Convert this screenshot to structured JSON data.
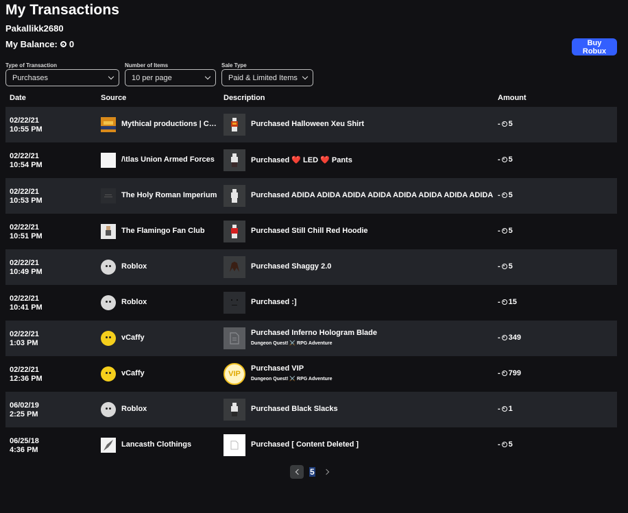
{
  "header": {
    "title": "My Transactions",
    "username": "Pakallikk2680",
    "balance_label": "My Balance:",
    "balance_value": "0",
    "buy_button": "Buy Robux"
  },
  "filters": {
    "type": {
      "label": "Type of Transaction",
      "value": "Purchases"
    },
    "items": {
      "label": "Number of Items",
      "value": "10 per page"
    },
    "sale": {
      "label": "Sale Type",
      "value": "Paid & Limited Items"
    }
  },
  "columns": {
    "date": "Date",
    "source": "Source",
    "description": "Description",
    "amount": "Amount"
  },
  "rows": [
    {
      "date": "02/22/21",
      "time": "10:55 PM",
      "source": "Mythical productions | CH...",
      "description": "Purchased Halloween Xeu Shirt",
      "sub": "",
      "amount": "-",
      "amount_value": "5"
    },
    {
      "date": "02/22/21",
      "time": "10:54 PM",
      "source": "/\\tlas Union Armed Forces",
      "description": "Purchased ❤️ LED ❤️ Pants",
      "sub": "",
      "amount": "-",
      "amount_value": "5"
    },
    {
      "date": "02/22/21",
      "time": "10:53 PM",
      "source": "The Holy Roman Imperium",
      "description": "Purchased ADIDA ADIDA ADIDA ADIDA ADIDA ADIDA ADIDA ADIDA",
      "sub": "",
      "amount": "-",
      "amount_value": "5"
    },
    {
      "date": "02/22/21",
      "time": "10:51 PM",
      "source": "The Flamingo Fan Club",
      "description": "Purchased Still Chill Red Hoodie",
      "sub": "",
      "amount": "-",
      "amount_value": "5"
    },
    {
      "date": "02/22/21",
      "time": "10:49 PM",
      "source": "Roblox",
      "description": "Purchased Shaggy 2.0",
      "sub": "",
      "amount": "-",
      "amount_value": "5"
    },
    {
      "date": "02/22/21",
      "time": "10:41 PM",
      "source": "Roblox",
      "description": "Purchased :]",
      "sub": "",
      "amount": "-",
      "amount_value": "15"
    },
    {
      "date": "02/22/21",
      "time": "1:03 PM",
      "source": "vCaffy",
      "description": "Purchased Inferno Hologram Blade",
      "sub": "Dungeon Quest! ⚔️ RPG Adventure",
      "amount": "-",
      "amount_value": "349"
    },
    {
      "date": "02/22/21",
      "time": "12:36 PM",
      "source": "vCaffy",
      "description": "Purchased VIP",
      "sub": "Dungeon Quest! ⚔️ RPG Adventure",
      "amount": "-",
      "amount_value": "799"
    },
    {
      "date": "06/02/19",
      "time": "2:25 PM",
      "source": "Roblox",
      "description": "Purchased Black Slacks",
      "sub": "",
      "amount": "-",
      "amount_value": "1"
    },
    {
      "date": "06/25/18",
      "time": "4:36 PM",
      "source": "Lancasth Clothings",
      "description": "Purchased [ Content Deleted ]",
      "sub": "",
      "amount": "-",
      "amount_value": "5"
    }
  ],
  "thumb_text": {
    "vip": "VIP"
  },
  "pagination": {
    "current": "5"
  },
  "colors": {
    "accent": "#335fff",
    "row_dark": "#23252a",
    "background": "#111114"
  }
}
